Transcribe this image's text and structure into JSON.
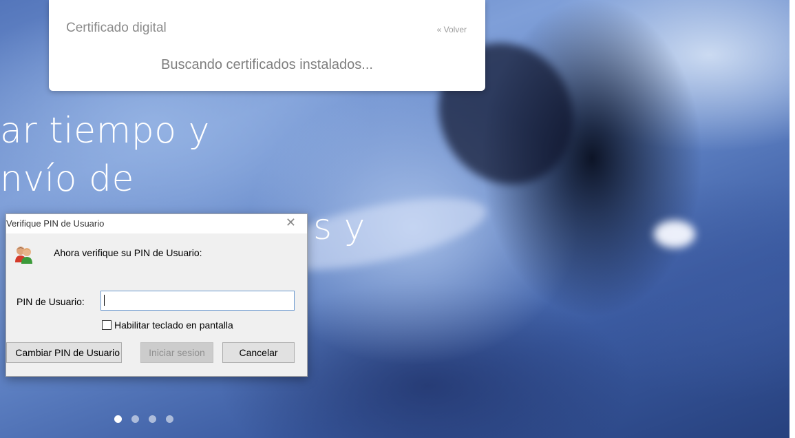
{
  "hero": {
    "headline": [
      "ar tiempo y",
      "nvío de",
      "s y"
    ],
    "carousel_dots": 4,
    "active_dot": 1
  },
  "cert_panel": {
    "title": "Certificado digital",
    "back_link": "« Volver",
    "status": "Buscando certificados instalados..."
  },
  "pin_dialog": {
    "title": "Verifique PIN de Usuario",
    "close_glyph": "✕",
    "icon": "users-icon",
    "prompt": "Ahora verifique su PIN de Usuario:",
    "pin_label": "PIN de Usuario:",
    "pin_value": "",
    "checkbox_label": "Habilitar teclado en pantalla",
    "checkbox_checked": false,
    "buttons": {
      "change_pin": "Cambiar PIN de Usuario",
      "login": "Iniciar sesion",
      "cancel": "Cancelar"
    }
  },
  "colors": {
    "hero_blue": "#5f82c4",
    "input_focus_border": "#6a98cf",
    "disabled_button": "#cccccc"
  }
}
